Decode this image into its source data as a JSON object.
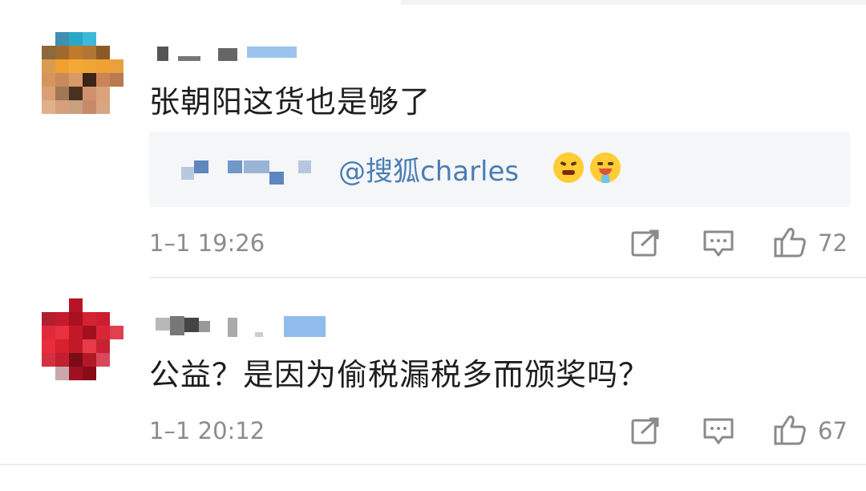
{
  "comments": [
    {
      "text": "张朝阳这货也是够了",
      "reply": {
        "mention": "@搜狐charles",
        "emojis": [
          "angry-face-icon",
          "drooling-face-icon"
        ]
      },
      "time": "1–1 19:26",
      "likes": "72"
    },
    {
      "text": "公益？是因为偷税漏税多而颁奖吗？",
      "time": "1–1 20:12",
      "likes": "67"
    }
  ],
  "colors": {
    "mention": "#4a7db5",
    "meta": "#8c8c8c",
    "reply_bg": "#f5f6f8"
  }
}
